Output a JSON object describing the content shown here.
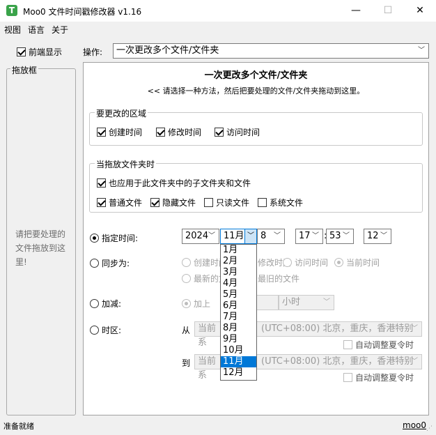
{
  "window": {
    "title": "Moo0 文件时间戳修改器 v1.16",
    "app_icon_letter": "T",
    "minimize": "—",
    "maximize": "☐",
    "close": "✕"
  },
  "menu": [
    "视图",
    "语言",
    "关于"
  ],
  "topbar": {
    "front_display": "前端显示",
    "operation_label": "操作:",
    "operation_value": "一次更改多个文件/文件夹"
  },
  "dropzone": {
    "title": "拖放框",
    "hint": "请把要处理的文件拖放到这里!"
  },
  "main": {
    "heading": "一次更改多个文件/文件夹",
    "subheading": "<< 请选择一种方法，然后把要处理的文件/文件夹拖动到这里。",
    "group_areas": {
      "label": "要更改的区域",
      "created": "创建时间",
      "modified": "修改时间",
      "accessed": "访问时间"
    },
    "group_folder": {
      "label": "当拖放文件夹时",
      "subfolders": "也应用于此文件夹中的子文件夹和文件",
      "normal": "普通文件",
      "hidden": "隐藏文件",
      "readonly": "只读文件",
      "system": "系统文件"
    },
    "specify": {
      "label": "指定时间:",
      "year": "2024",
      "month": "11月",
      "day": "8",
      "hour": "17",
      "minute": "53",
      "second": "12",
      "colon": ":"
    },
    "sync": {
      "label": "同步为:",
      "created": "创建时间",
      "modified": "修改时间",
      "accessed": "访问时间",
      "current": "当前时间",
      "newest": "最新的文件",
      "oldest": "最旧的文件"
    },
    "add": {
      "label": "加减:",
      "plus": "加上",
      "unit": "小时"
    },
    "timezone": {
      "label": "时区:",
      "from": "从",
      "to": "到",
      "current_prefix": "当前系",
      "tz_text": "(UTC+08:00) 北京，重庆，香港特别",
      "dst": "自动调整夏令时"
    }
  },
  "month_list": [
    "1月",
    "2月",
    "3月",
    "4月",
    "5月",
    "6月",
    "7月",
    "8月",
    "9月",
    "10月",
    "11月",
    "12月"
  ],
  "status": {
    "text": "准备就绪",
    "link": "moo0"
  }
}
